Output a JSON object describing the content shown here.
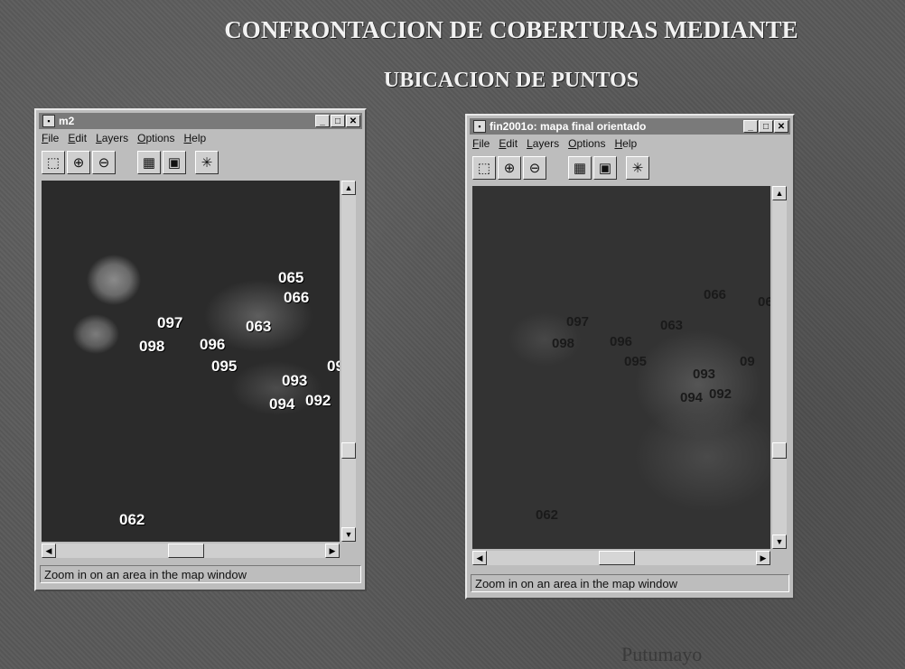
{
  "slide": {
    "title_line1": "CONFRONTACION DE COBERTURAS MEDIANTE",
    "title_line2": "UBICACION DE PUNTOS",
    "footer": "Putumayo"
  },
  "window_left": {
    "title": "m2",
    "menu": [
      "File",
      "Edit",
      "Layers",
      "Options",
      "Help"
    ],
    "status": "Zoom in on an area in the map window",
    "points": [
      "065",
      "066",
      "097",
      "063",
      "098",
      "096",
      "095",
      "093",
      "09",
      "094",
      "092",
      "062"
    ]
  },
  "window_right": {
    "title": "fin2001o: mapa final orientado",
    "menu": [
      "File",
      "Edit",
      "Layers",
      "Options",
      "Help"
    ],
    "status": "Zoom in on an area in the map window",
    "points": [
      "066",
      "06",
      "097",
      "063",
      "098",
      "096",
      "095",
      "093",
      "09",
      "094",
      "092",
      "062"
    ]
  },
  "icons": {
    "window_controls": [
      "minimize-icon",
      "maximize-icon",
      "close-icon"
    ],
    "tools": [
      "select-icon",
      "zoom-in-icon",
      "zoom-out-icon",
      "pan-icon",
      "full-extent-icon",
      "identify-icon"
    ]
  }
}
